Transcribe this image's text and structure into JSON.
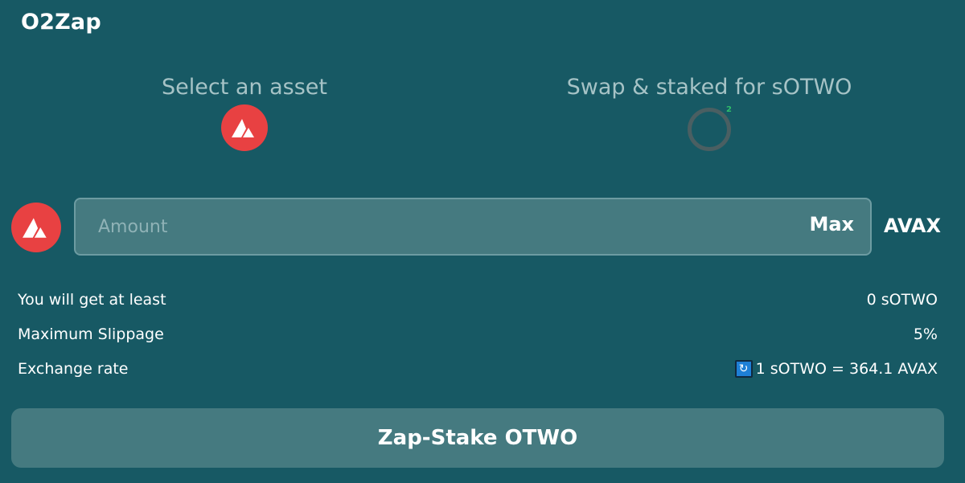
{
  "app": {
    "title": "O2Zap"
  },
  "steps": {
    "select_label": "Select an asset",
    "swap_label": "Swap & staked for sOTWO",
    "sotwo_badge": "2"
  },
  "amount": {
    "placeholder": "Amount",
    "value": "",
    "max_label": "Max",
    "unit": "AVAX"
  },
  "info": {
    "get_at_least": {
      "label": "You will get at least",
      "value": "0 sOTWO"
    },
    "slippage": {
      "label": "Maximum Slippage",
      "value": "5%"
    },
    "exchange_rate": {
      "label": "Exchange rate",
      "value": "1 sOTWO = 364.1 AVAX",
      "icon": "refresh-icon"
    }
  },
  "actions": {
    "zap_label": "Zap-Stake OTWO"
  },
  "colors": {
    "background": "#175964",
    "field": "#457a80",
    "avax_red": "#e84142",
    "muted_text": "#a6c3c6"
  }
}
